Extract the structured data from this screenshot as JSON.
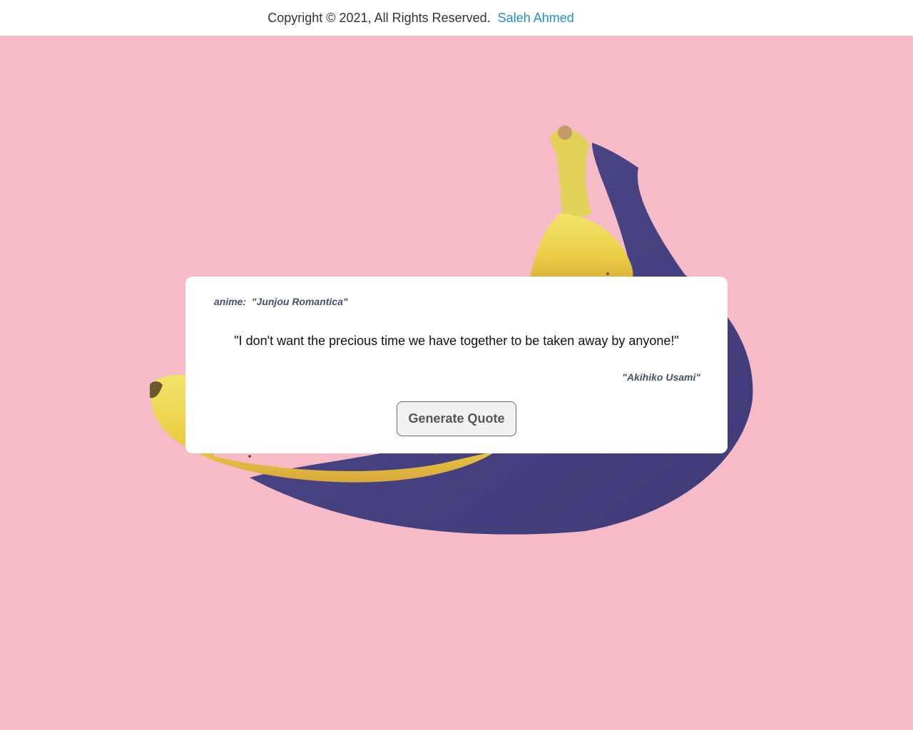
{
  "footer": {
    "copyright_text": "Copyright © 2021, All Rights Reserved.",
    "author_link": "Saleh Ahmed",
    "author_link_color": "#1f8de0"
  },
  "background": {
    "color": "#f7bac7",
    "image": "banana-on-pink"
  },
  "quote_card": {
    "anime_label": "anime:",
    "anime_title": "\"Junjou Romantica\"",
    "quote": "\"I don't want the precious time we have together to be taken away by anyone!\"",
    "character": "\"Akihiko Usami\"",
    "button_label": "Generate Quote"
  }
}
